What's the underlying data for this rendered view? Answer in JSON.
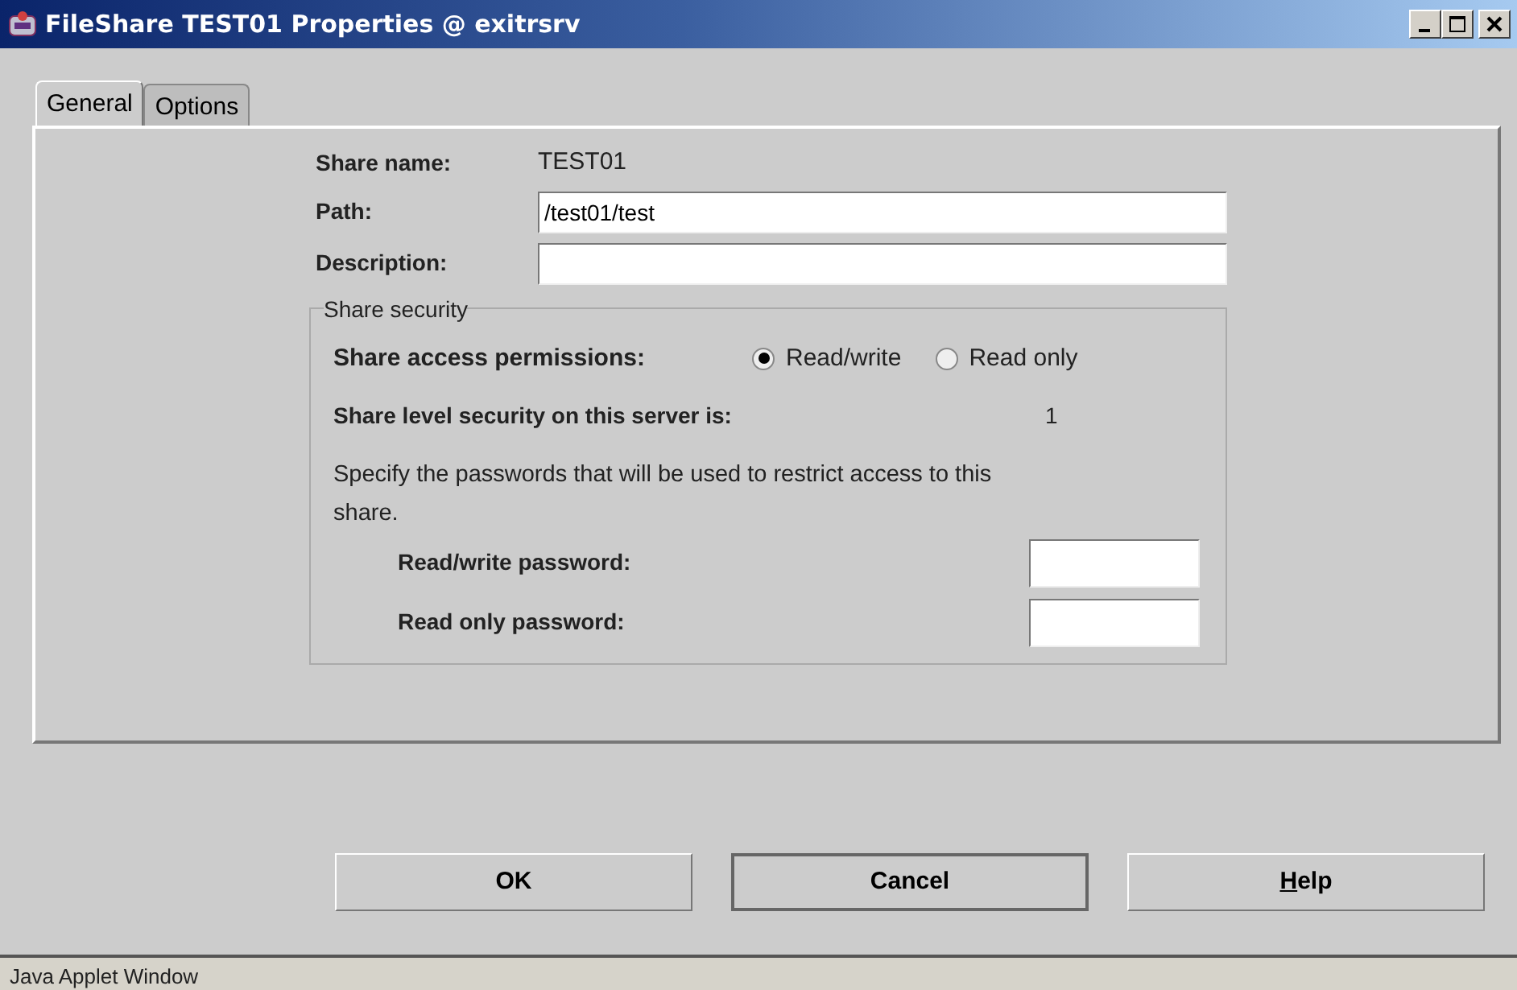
{
  "window": {
    "title": "FileShare TEST01 Properties @ exitrsrv"
  },
  "tabs": [
    {
      "label": "General",
      "selected": true
    },
    {
      "label": "Options",
      "selected": false
    }
  ],
  "general": {
    "share_name": {
      "label": "Share name:",
      "value": "TEST01"
    },
    "path": {
      "label": "Path:",
      "value": "/test01/test"
    },
    "description": {
      "label": "Description:"
    }
  },
  "security": {
    "title": "Share security",
    "permissions_label": "Share access permissions:",
    "options": [
      {
        "label": "Read/write",
        "selected": true
      },
      {
        "label": "Read only",
        "selected": false
      }
    ],
    "level_label": "Share level security on this server is:",
    "level_value": "1",
    "note": "Specify the passwords that will be used to restrict access to this share.",
    "passwords": [
      {
        "label": "Read/write password:"
      },
      {
        "label": "Read only password:"
      }
    ]
  },
  "buttons": [
    {
      "label": "OK",
      "focused": false,
      "underline_first": false
    },
    {
      "label": "Cancel",
      "focused": true,
      "underline_first": false
    },
    {
      "label": "Help",
      "focused": false,
      "underline_first": true
    }
  ],
  "status_bar": "Java Applet Window"
}
